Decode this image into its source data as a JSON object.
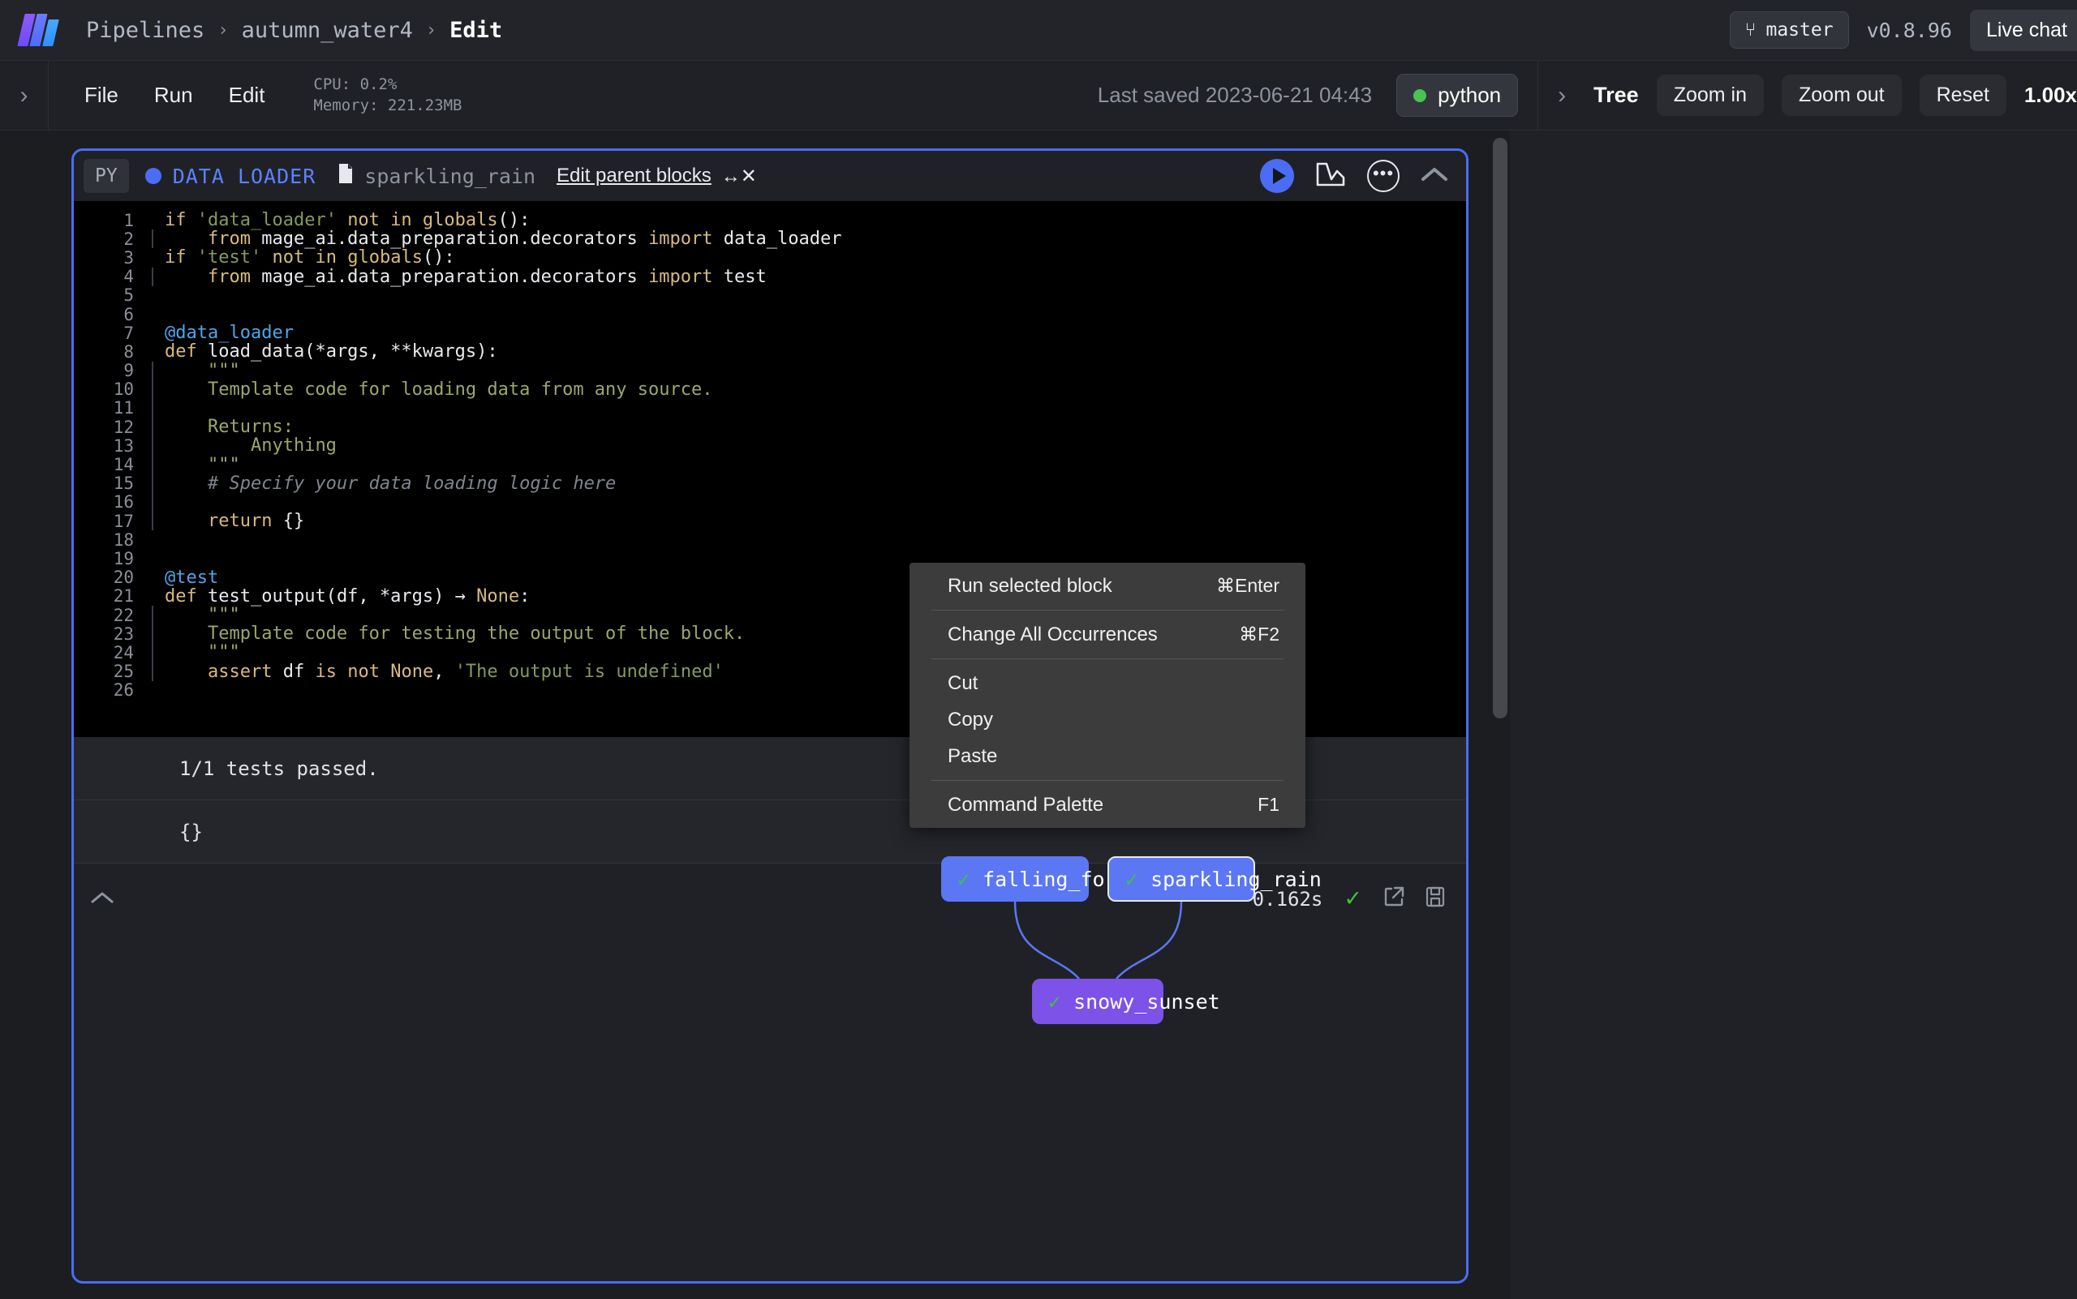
{
  "topbar": {
    "logo_name": "mage-logo",
    "breadcrumb": [
      "Pipelines",
      "autumn_water4",
      "Edit"
    ],
    "separator": "›",
    "branch_icon": "⑂",
    "branch": "master",
    "version": "v0.8.96",
    "live_chat": "Live chat"
  },
  "toolbar": {
    "collapse_icon": "›",
    "menus": [
      "File",
      "Run",
      "Edit"
    ],
    "cpu": "CPU: 0.2%",
    "memory": "Memory: 221.23MB",
    "last_saved": "Last saved 2023-06-21 04:43",
    "kernel": "python",
    "kernel_color": "#49c352",
    "tree_collapse_icon": "›",
    "tree_title": "Tree",
    "zoom_in": "Zoom in",
    "zoom_out": "Zoom out",
    "reset": "Reset",
    "zoom_level": "1.00x"
  },
  "block": {
    "language_tag": "PY",
    "type_label": "DATA LOADER",
    "type_color": "#5b82ff",
    "name": "sparkling_rain",
    "edit_parent_blocks": "Edit parent blocks",
    "arrow_x": "↔✕",
    "run_icon": "play-icon",
    "chart_icon": "chart-icon",
    "more_icon": "•••",
    "collapse_icon": "⌃",
    "accent_color": "#4b6cf4",
    "code_lines": [
      {
        "n": 1,
        "guide": false,
        "html": "<span class='kw'>if</span> <span class='str'>'data_loader'</span> <span class='kw'>not in</span> <span class='kw'>globals</span><span class='id'>():</span>"
      },
      {
        "n": 2,
        "guide": true,
        "html": "    <span class='kw'>from</span> <span class='id'>mage_ai.data_preparation.decorators</span> <span class='kw'>import</span> <span class='id'>data_loader</span>"
      },
      {
        "n": 3,
        "guide": false,
        "html": "<span class='kw'>if</span> <span class='str'>'test'</span> <span class='kw'>not in</span> <span class='kw'>globals</span><span class='id'>():</span>"
      },
      {
        "n": 4,
        "guide": true,
        "html": "    <span class='kw'>from</span> <span class='id'>mage_ai.data_preparation.decorators</span> <span class='kw'>import</span> <span class='id'>test</span>"
      },
      {
        "n": 5,
        "guide": false,
        "html": ""
      },
      {
        "n": 6,
        "guide": false,
        "html": ""
      },
      {
        "n": 7,
        "guide": false,
        "html": "<span class='dec'>@data_loader</span>"
      },
      {
        "n": 8,
        "guide": false,
        "html": "<span class='kw'>def</span> <span class='id'>load_data(*args, **kwargs):</span>"
      },
      {
        "n": 9,
        "guide": true,
        "html": "    <span class='doc'>\"\"\"</span>"
      },
      {
        "n": 10,
        "guide": true,
        "html": "    <span class='doc'>Template code for loading data from any source.</span>"
      },
      {
        "n": 11,
        "guide": true,
        "html": ""
      },
      {
        "n": 12,
        "guide": true,
        "html": "    <span class='doc'>Returns:</span>"
      },
      {
        "n": 13,
        "guide": true,
        "html": "        <span class='doc'>Anything</span>"
      },
      {
        "n": 14,
        "guide": true,
        "html": "    <span class='doc'>\"\"\"</span>"
      },
      {
        "n": 15,
        "guide": true,
        "html": "    <span class='com'># Specify your data loading logic here</span>"
      },
      {
        "n": 16,
        "guide": true,
        "html": ""
      },
      {
        "n": 17,
        "guide": true,
        "html": "    <span class='kw'>return</span> <span class='id'>{}</span>"
      },
      {
        "n": 18,
        "guide": false,
        "html": ""
      },
      {
        "n": 19,
        "guide": false,
        "html": ""
      },
      {
        "n": 20,
        "guide": false,
        "html": "<span class='dec'>@test</span>"
      },
      {
        "n": 21,
        "guide": false,
        "html": "<span class='kw'>def</span> <span class='id'>test_output(df, *args)</span> <span class='id'>→</span> <span class='kw'>None</span><span class='id'>:</span>"
      },
      {
        "n": 22,
        "guide": true,
        "html": "    <span class='doc'>\"\"\"</span>"
      },
      {
        "n": 23,
        "guide": true,
        "html": "    <span class='doc'>Template code for testing the output of the block.</span>"
      },
      {
        "n": 24,
        "guide": true,
        "html": "    <span class='doc'>\"\"\"</span>"
      },
      {
        "n": 25,
        "guide": true,
        "html": "    <span class='kw'>assert</span> <span class='id'>df</span> <span class='kw'>is not</span> <span class='kw'>None</span><span class='id'>,</span> <span class='str'>'The output is undefined'</span>"
      },
      {
        "n": 26,
        "guide": false,
        "html": ""
      }
    ],
    "output_tests": "1/1 tests passed.",
    "output_value": "{}",
    "footer_collapse_icon": "⌃",
    "runtime": "0.162s",
    "status_check": "✓",
    "expand_icon": "open-external-icon",
    "save_icon": "save-icon"
  },
  "context_menu": {
    "groups": [
      [
        {
          "label": "Run selected block",
          "shortcut": "⌘Enter"
        }
      ],
      [
        {
          "label": "Change All Occurrences",
          "shortcut": "⌘F2"
        }
      ],
      [
        {
          "label": "Cut",
          "shortcut": ""
        },
        {
          "label": "Copy",
          "shortcut": ""
        },
        {
          "label": "Paste",
          "shortcut": ""
        }
      ],
      [
        {
          "label": "Command Palette",
          "shortcut": "F1"
        }
      ]
    ]
  },
  "tree": {
    "nodes": [
      {
        "id": "falling",
        "label": "falling_forest",
        "status": "✓",
        "color": "#5b77f4",
        "selected": false
      },
      {
        "id": "sparkling",
        "label": "sparkling_rain",
        "status": "✓",
        "color": "#5b77f4",
        "selected": true
      },
      {
        "id": "snowy",
        "label": "snowy_sunset",
        "status": "✓",
        "color": "#7c52e8",
        "selected": false
      }
    ],
    "edge_color": "#5b77f4"
  }
}
